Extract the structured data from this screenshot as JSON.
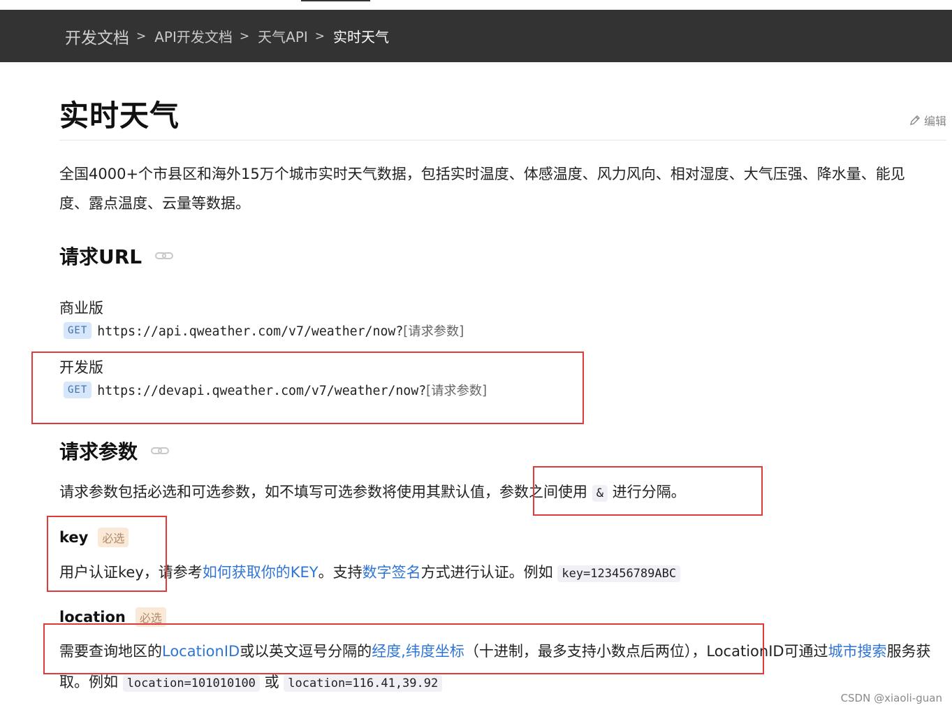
{
  "breadcrumb": [
    "开发文档",
    "API开发文档",
    "天气API",
    "实时天气"
  ],
  "breadcrumb_separator": ">",
  "page": {
    "title": "实时天气",
    "edit_label": "编辑",
    "description": "全国4000+个市县区和海外15万个城市实时天气数据，包括实时温度、体感温度、风力风向、相对湿度、大气压强、降水量、能见度、露点温度、云量等数据。"
  },
  "request_url": {
    "heading": "请求URL",
    "commercial": {
      "label": "商业版",
      "method": "GET",
      "url": "https://api.qweather.com/v7/weather/now?",
      "params": "[请求参数]"
    },
    "developer": {
      "label": "开发版",
      "method": "GET",
      "url": "https://devapi.qweather.com/v7/weather/now?",
      "params": "[请求参数]"
    }
  },
  "request_params": {
    "heading": "请求参数",
    "intro_before": "请求参数包括必选和可选参数，如不填写可选参数将使用其默认值，参数之间使用",
    "intro_code": "&",
    "intro_after": "进行分隔。",
    "key": {
      "name": "key",
      "badge": "必选",
      "t1": "用户认证key，请参考",
      "link1": "如何获取你的KEY",
      "t2": "。支持",
      "link2": "数字签名",
      "t3": "方式进行认证。例如",
      "code": "key=123456789ABC"
    },
    "location": {
      "name": "location",
      "badge": "必选",
      "t1": "需要查询地区的",
      "link1": "LocationID",
      "t2": "或以英文逗号分隔的",
      "link2": "经度,纬度坐标",
      "t3": "（十进制，最多支持小数点后两位），LocationID可通过",
      "link3": "城市搜索",
      "t4": "服务获取。例如",
      "code1": "location=101010100",
      "t5": "或",
      "code2": "location=116.41,39.92"
    }
  },
  "watermark": "CSDN @xiaoli-guan",
  "colors": {
    "header_bg": "#333333",
    "link": "#2f75d6",
    "highlight_box": "#e03a3a",
    "get_badge_bg": "#d6e6fb",
    "required_badge_bg": "#fbe9d8"
  },
  "icons": {
    "edit": "pencil-icon",
    "anchor": "link-icon"
  }
}
